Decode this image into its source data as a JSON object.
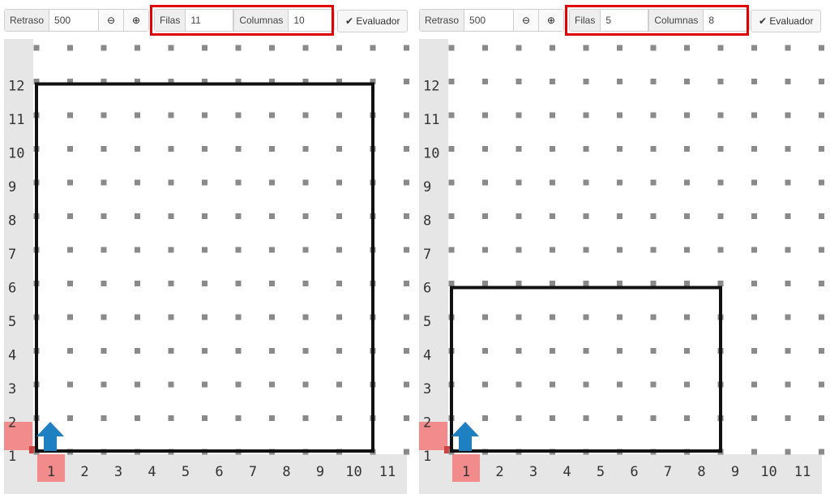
{
  "left": {
    "toolbar": {
      "delay_label": "Retraso",
      "delay_value": "500",
      "rows_label": "Filas",
      "rows_value": "11",
      "cols_label": "Columnas",
      "cols_value": "10",
      "evaluate_label": "Evaluador"
    },
    "grid": {
      "y_labels": [
        "1",
        "2",
        "3",
        "4",
        "5",
        "6",
        "7",
        "8",
        "9",
        "10",
        "11",
        "12"
      ],
      "x_labels": [
        "1",
        "2",
        "3",
        "4",
        "5",
        "6",
        "7",
        "8",
        "9",
        "10",
        "11"
      ]
    }
  },
  "right": {
    "toolbar": {
      "delay_label": "Retraso",
      "delay_value": "500",
      "rows_label": "Filas",
      "rows_value": "5",
      "cols_label": "Columnas",
      "cols_value": "8",
      "evaluate_label": "Evaluador"
    },
    "grid": {
      "y_labels": [
        "1",
        "2",
        "3",
        "4",
        "5",
        "6",
        "7",
        "8",
        "9",
        "10",
        "11",
        "12"
      ],
      "x_labels": [
        "1",
        "2",
        "3",
        "4",
        "5",
        "6",
        "7",
        "8",
        "9",
        "10",
        "11"
      ]
    }
  },
  "colors": {
    "border": "#111111",
    "arrow": "#1e7fc1",
    "highlight": "#f28b8b",
    "dot": "#8a8a8a",
    "axis_bg": "#e6e6e6",
    "callout": "#e00000"
  },
  "icons": {
    "decrease": "minus-circle-icon",
    "increase": "plus-circle-icon",
    "evaluate": "checkmark-icon",
    "robot": "up-arrow-icon"
  }
}
